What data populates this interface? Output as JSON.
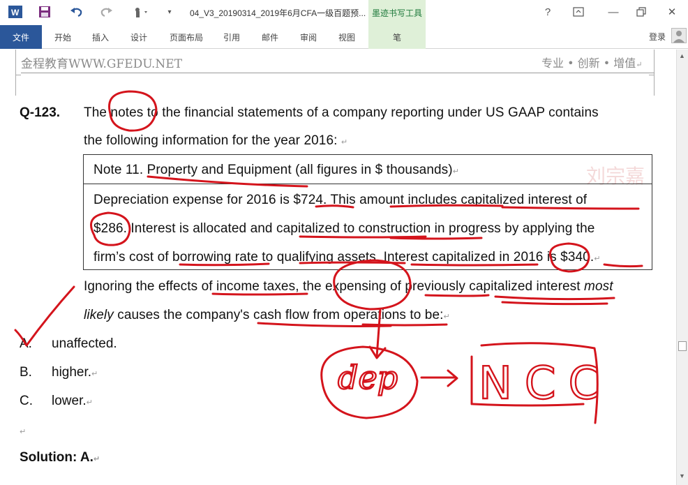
{
  "titlebar": {
    "doc_title": "04_V3_20190314_2019年6月CFA一级百题预...",
    "context_tab_title": "墨迹书写工具",
    "help": "?",
    "minimize": "—",
    "close": "✕"
  },
  "ribbon": {
    "tabs": [
      "文件",
      "开始",
      "插入",
      "设计",
      "页面布局",
      "引用",
      "邮件",
      "审阅",
      "视图",
      "笔"
    ],
    "login": "登录"
  },
  "page_header": {
    "left": "金程教育WWW.GFEDU.NET",
    "right": "专业 • 创新 • 增值"
  },
  "question": {
    "label": "Q-123.",
    "line1": "The notes to the financial statements of a company reporting under US GAAP contains",
    "line2": "the following information for the year 2016:",
    "note_title": "Note 11. Property and Equipment (all figures in $ thousands)",
    "note_line1": "Depreciation expense for 2016 is $724. This amount includes capitalized interest of",
    "note_line2": "$286.   Interest is allocated and capitalized to construction in progress by applying the",
    "note_line3": "firm’s cost of borrowing rate to qualifying assets. Interest capitalized in 2016 is $340.",
    "stem_line1_a": "Ignoring the effects of income taxes, the expensing of previously capitalized interest ",
    "stem_line1_b": "most",
    "stem_line2_a": "likely",
    "stem_line2_b": " causes the company's cash flow from operations to be:"
  },
  "answers": [
    {
      "letter": "A.",
      "text": "unaffected."
    },
    {
      "letter": "B.",
      "text": "higher."
    },
    {
      "letter": "C.",
      "text": "lower."
    }
  ],
  "solution_label": "Solution: A.",
  "ink_annotations": {
    "word1": "dep",
    "word2": "NCC",
    "color": "#d4141c"
  },
  "watermark": "刘宗嘉"
}
